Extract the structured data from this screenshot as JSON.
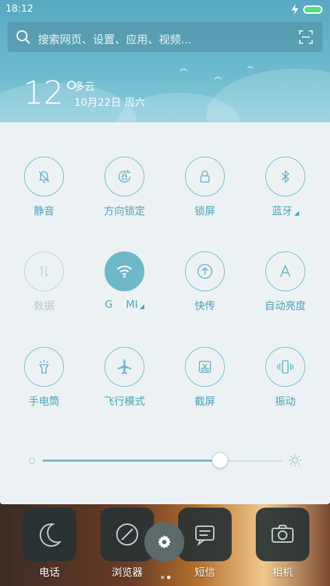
{
  "status": {
    "time": "18:12"
  },
  "search": {
    "placeholder": "搜索网页、设置、应用、视频..."
  },
  "weather": {
    "temp": "12°",
    "condition": "多云",
    "date": "10月22日 周六"
  },
  "toggles": [
    {
      "label": "静音",
      "icon": "bell-off-icon",
      "state": "off"
    },
    {
      "label": "方向锁定",
      "icon": "rotation-lock-icon",
      "state": "off"
    },
    {
      "label": "锁屏",
      "icon": "lock-icon",
      "state": "off"
    },
    {
      "label": "蓝牙",
      "icon": "bluetooth-icon",
      "state": "off",
      "has_more": true
    },
    {
      "label": "数据",
      "icon": "data-arrows-icon",
      "state": "disabled"
    },
    {
      "label": "G    MI",
      "icon": "wifi-icon",
      "state": "on",
      "has_more": true
    },
    {
      "label": "快传",
      "icon": "upload-circle-icon",
      "state": "off"
    },
    {
      "label": "自动亮度",
      "icon": "letter-a-icon",
      "state": "off"
    },
    {
      "label": "手电筒",
      "icon": "flashlight-icon",
      "state": "off"
    },
    {
      "label": "飞行模式",
      "icon": "airplane-icon",
      "state": "off"
    },
    {
      "label": "截屏",
      "icon": "screenshot-scissors-icon",
      "state": "off"
    },
    {
      "label": "振动",
      "icon": "vibrate-icon",
      "state": "off"
    }
  ],
  "brightness": {
    "level": 0.74
  },
  "dock": {
    "apps": [
      {
        "label": "电话",
        "icon": "moon-icon"
      },
      {
        "label": "浏览器",
        "icon": "compass-icon"
      },
      {
        "label": "短信",
        "icon": "message-icon"
      },
      {
        "label": "相机",
        "icon": "camera-icon"
      }
    ]
  },
  "colors": {
    "accent": "#6fb8c9",
    "header": "#62b0c8",
    "panel": "#ecf2f4"
  }
}
